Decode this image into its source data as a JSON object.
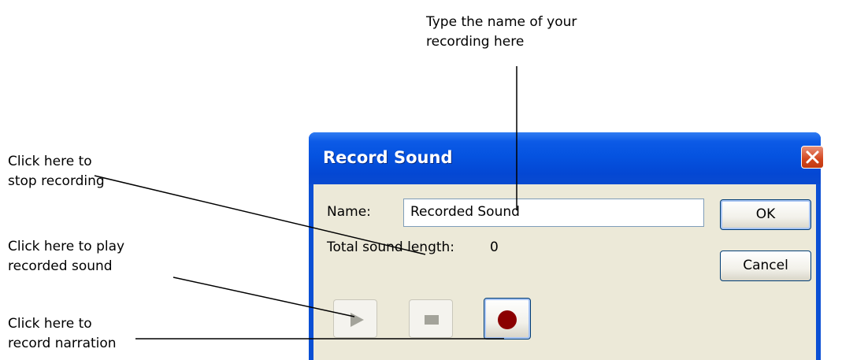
{
  "annotations": {
    "name_callout": [
      "Type the name of your",
      "recording here"
    ],
    "stop_callout": [
      "Click here to",
      "stop recording"
    ],
    "play_callout": [
      "Click here to play",
      "recorded sound"
    ],
    "record_callout": [
      "Click here to",
      "record narration"
    ]
  },
  "dialog": {
    "title": "Record Sound",
    "name_label": "Name:",
    "name_value": "Recorded Sound",
    "length_label": "Total sound length:",
    "length_value": "0",
    "ok_label": "OK",
    "cancel_label": "Cancel",
    "play_icon": "play-icon",
    "stop_icon": "stop-icon",
    "record_icon": "record-icon",
    "close_icon": "close-icon"
  },
  "colors": {
    "title_bar": "#0553e0",
    "dialog_face": "#ece9d8",
    "record_dot": "#8b0000",
    "close_red": "#d3451c"
  }
}
